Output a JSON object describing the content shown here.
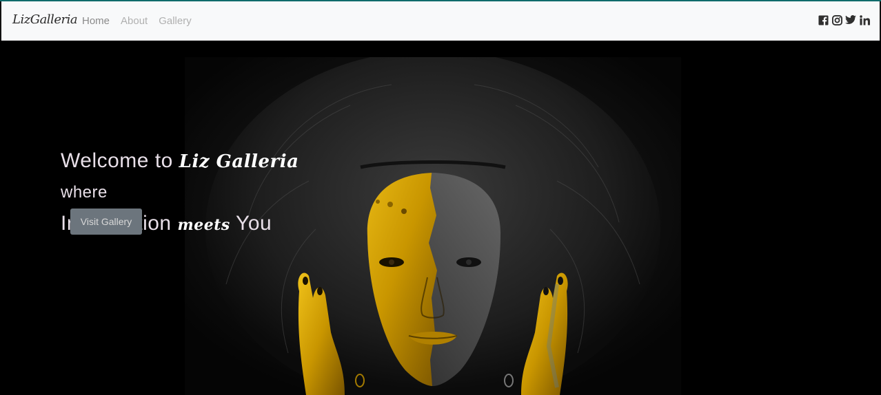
{
  "brand": "LizGalleria",
  "nav": {
    "items": [
      {
        "label": "Home",
        "active": true
      },
      {
        "label": "About",
        "active": false
      },
      {
        "label": "Gallery",
        "active": false
      }
    ]
  },
  "social": {
    "icons": [
      "facebook-icon",
      "instagram-icon",
      "twitter-icon",
      "linkedin-icon"
    ]
  },
  "hero": {
    "line1_prefix": "Welcome to ",
    "line1_script": "Liz Galleria",
    "line2": "where",
    "line3_prefix": "Imagination ",
    "line3_script": "meets",
    "line3_suffix": " You",
    "button_label": "Visit Gallery"
  },
  "colors": {
    "navbar_bg": "#f8f9fa",
    "top_accent": "#0f6b6b",
    "button_bg": "#6c757d",
    "gold": "#d4a000"
  }
}
